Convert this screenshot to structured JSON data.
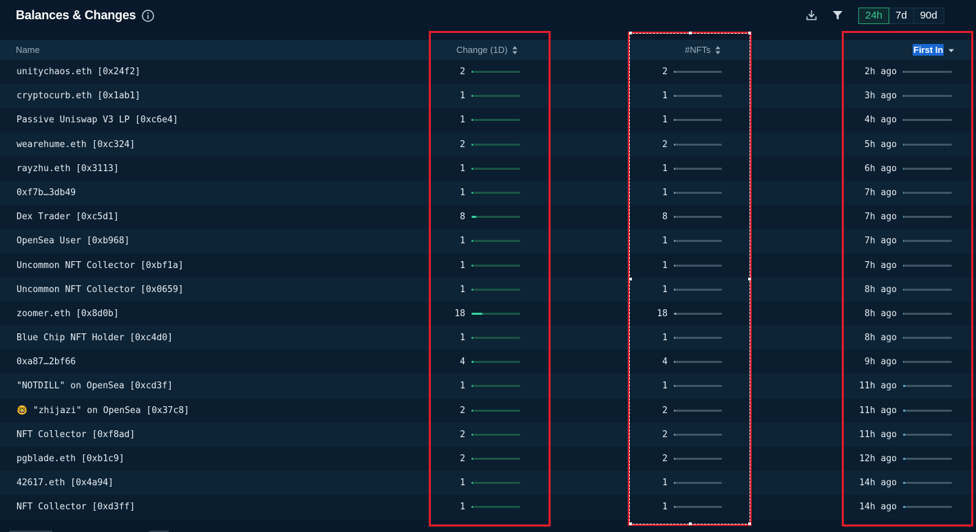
{
  "header": {
    "title": "Balances & Changes",
    "ranges": [
      "24h",
      "7d",
      "90d"
    ],
    "active_range": "24h",
    "icons": {
      "info": "info-icon",
      "download": "download-icon",
      "filter": "filter-icon"
    }
  },
  "columns": {
    "name": "Name",
    "change": "Change (1D)",
    "nfts": "#NFTs",
    "first_in": "First In"
  },
  "colors": {
    "accent_green": "#33d69f",
    "highlight_red": "#e11d2b",
    "background": "#08192b"
  },
  "rows": [
    {
      "name": "unitychaos.eth [0x24f2]",
      "change": "2",
      "nfts": "2",
      "first_in": "2h ago"
    },
    {
      "name": "cryptocurb.eth [0x1ab1]",
      "change": "1",
      "nfts": "1",
      "first_in": "3h ago"
    },
    {
      "name": "Passive Uniswap V3 LP [0xc6e4]",
      "change": "1",
      "nfts": "1",
      "first_in": "4h ago"
    },
    {
      "name": "wearehume.eth [0xc324]",
      "change": "2",
      "nfts": "2",
      "first_in": "5h ago"
    },
    {
      "name": "rayzhu.eth [0x3113]",
      "change": "1",
      "nfts": "1",
      "first_in": "6h ago"
    },
    {
      "name": "0xf7b…3db49",
      "change": "1",
      "nfts": "1",
      "first_in": "7h ago"
    },
    {
      "name": "Dex Trader [0xc5d1]",
      "change": "8",
      "nfts": "8",
      "first_in": "7h ago"
    },
    {
      "name": "OpenSea User [0xb968]",
      "change": "1",
      "nfts": "1",
      "first_in": "7h ago"
    },
    {
      "name": "Uncommon NFT Collector [0xbf1a]",
      "change": "1",
      "nfts": "1",
      "first_in": "7h ago"
    },
    {
      "name": "Uncommon NFT Collector [0x0659]",
      "change": "1",
      "nfts": "1",
      "first_in": "8h ago"
    },
    {
      "name": "zoomer.eth [0x8d0b]",
      "change": "18",
      "nfts": "18",
      "first_in": "8h ago"
    },
    {
      "name": "Blue Chip NFT Holder [0xc4d0]",
      "change": "1",
      "nfts": "1",
      "first_in": "8h ago"
    },
    {
      "name": "0xa87…2bf66",
      "change": "4",
      "nfts": "4",
      "first_in": "9h ago"
    },
    {
      "name": "\"NOTDILL\" on OpenSea [0xcd3f]",
      "change": "1",
      "nfts": "1",
      "first_in": "11h ago"
    },
    {
      "name": "🤓 \"zhijazi\" on OpenSea [0x37c8]",
      "change": "2",
      "nfts": "2",
      "first_in": "11h ago"
    },
    {
      "name": "NFT Collector [0xf8ad]",
      "change": "2",
      "nfts": "2",
      "first_in": "11h ago"
    },
    {
      "name": "pgblade.eth [0xb1c9]",
      "change": "2",
      "nfts": "2",
      "first_in": "12h ago"
    },
    {
      "name": "42617.eth [0x4a94]",
      "change": "1",
      "nfts": "1",
      "first_in": "14h ago"
    },
    {
      "name": "NFT Collector [0xd3ff]",
      "change": "1",
      "nfts": "1",
      "first_in": "14h ago"
    }
  ]
}
